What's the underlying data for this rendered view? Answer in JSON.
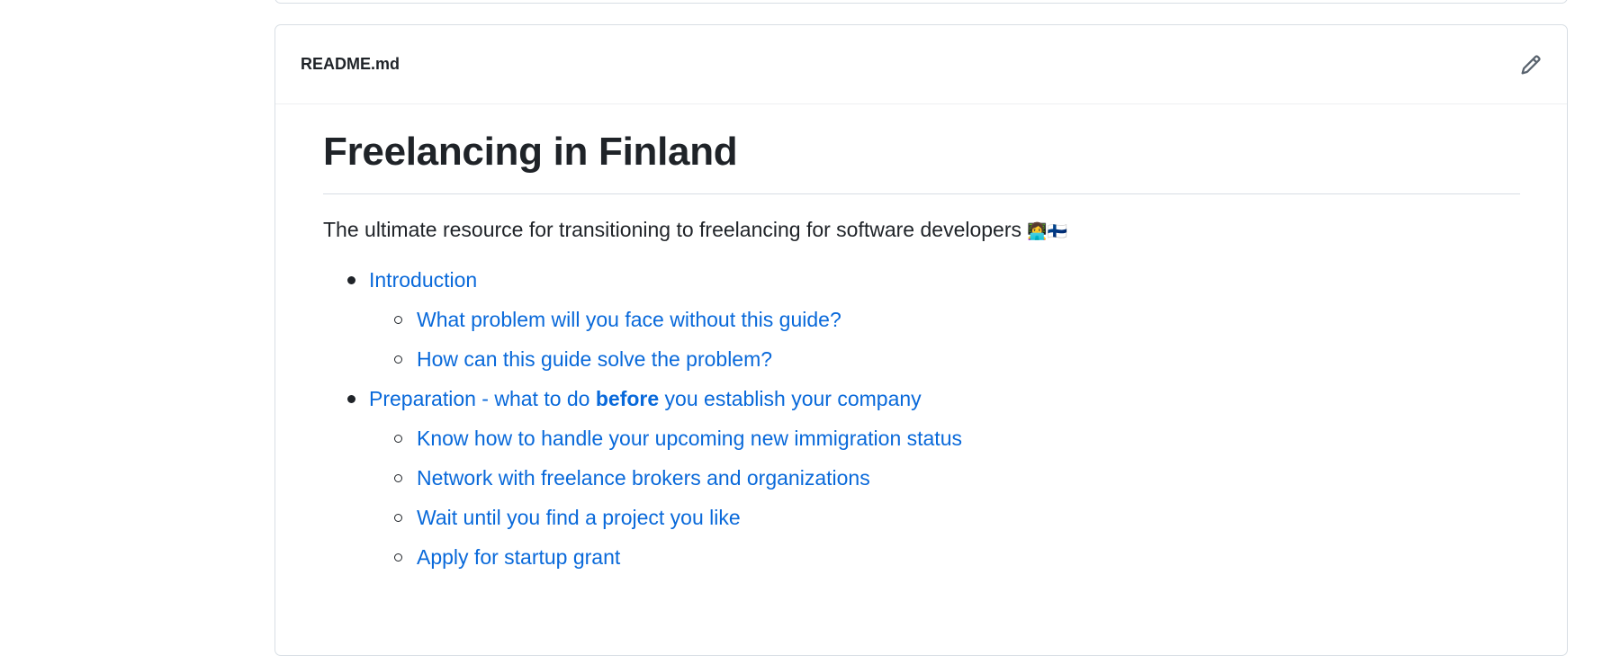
{
  "readme": {
    "filename": "README.md",
    "edit_icon": "pencil-icon",
    "title": "Freelancing in Finland",
    "description": "The ultimate resource for transitioning to freelancing for software developers",
    "description_emoji": "👩‍💻🇫🇮",
    "toc": [
      {
        "label": "Introduction",
        "children": [
          {
            "label": "What problem will you face without this guide?"
          },
          {
            "label": "How can this guide solve the problem?"
          }
        ]
      },
      {
        "label_pre": "Preparation - what to do ",
        "label_bold": "before",
        "label_post": " you establish your company",
        "children": [
          {
            "label": "Know how to handle your upcoming new immigration status"
          },
          {
            "label": "Network with freelance brokers and organizations"
          },
          {
            "label": "Wait until you find a project you like"
          },
          {
            "label": "Apply for startup grant"
          }
        ]
      }
    ]
  },
  "colors": {
    "link": "#0969da",
    "text": "#1f2328",
    "border": "#d8dee4"
  }
}
